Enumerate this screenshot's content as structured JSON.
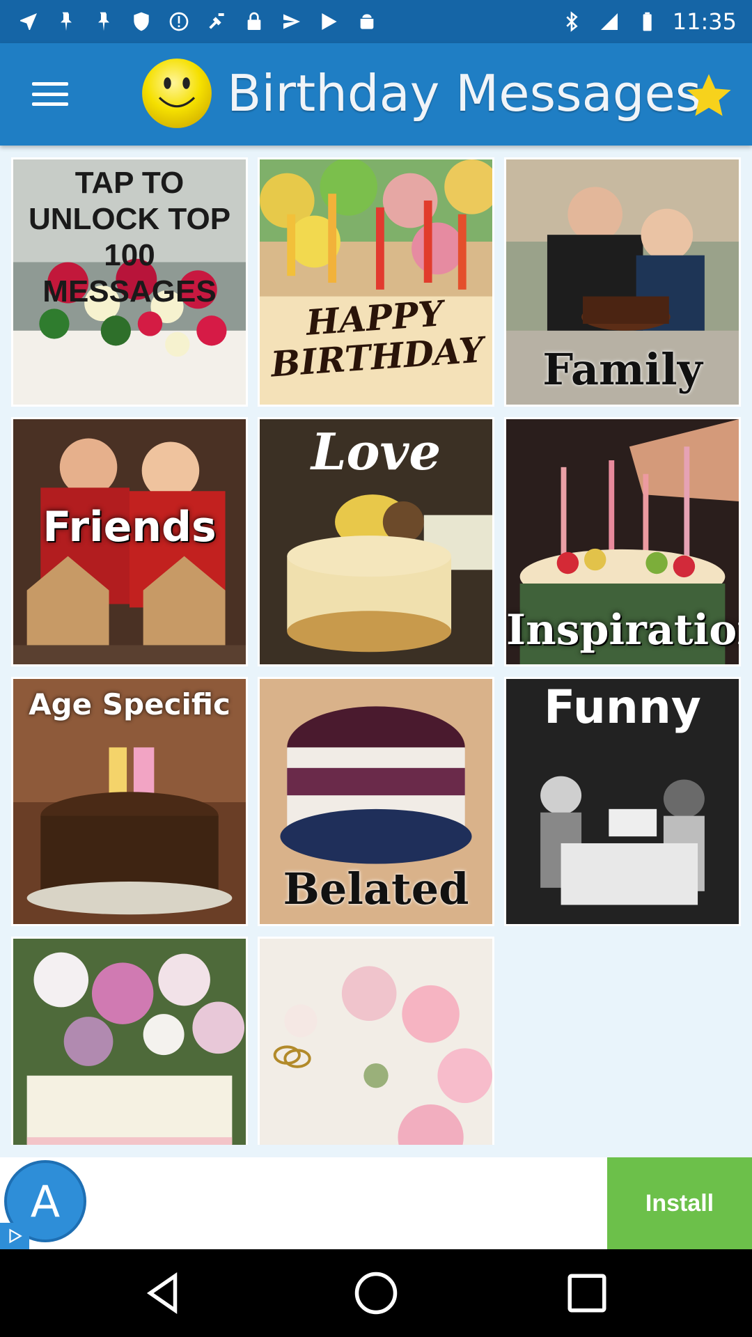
{
  "status_bar": {
    "time": "11:35",
    "left_icons": [
      "navigation-icon",
      "pin-icon",
      "pin-icon",
      "shield-icon",
      "info-icon",
      "fake-gps-icon",
      "lock-icon",
      "send-icon",
      "play-store-icon",
      "android-icon"
    ],
    "right_icons": [
      "bluetooth-icon",
      "signal-icon",
      "battery-icon"
    ]
  },
  "app_bar": {
    "title": "Birthday Messages",
    "menu_icon": "hamburger-menu-icon",
    "favorite_icon": "star-icon",
    "background": "#1f7ec4",
    "star_color": "#f7d21c"
  },
  "tiles": [
    {
      "label": "TAP TO UNLOCK TOP 100 MESSAGES",
      "name": "tile-unlock-top-100"
    },
    {
      "label": "HAPPY BIRTHDAY",
      "name": "tile-happy-birthday"
    },
    {
      "label": "Family",
      "name": "tile-family"
    },
    {
      "label": "Friends",
      "name": "tile-friends"
    },
    {
      "label": "Love",
      "name": "tile-love"
    },
    {
      "label": "Inspirational",
      "name": "tile-inspirational"
    },
    {
      "label": "Age Specific",
      "name": "tile-age-specific"
    },
    {
      "label": "Belated",
      "name": "tile-belated"
    },
    {
      "label": "Funny",
      "name": "tile-funny"
    },
    {
      "label": "",
      "name": "tile-religious"
    },
    {
      "label": "",
      "name": "tile-marriage"
    }
  ],
  "ad": {
    "logo_letter": "A",
    "install_label": "Install",
    "install_color": "#6cc04a"
  },
  "nav_bar": {
    "buttons": [
      "back-icon",
      "home-icon",
      "recents-icon"
    ]
  }
}
